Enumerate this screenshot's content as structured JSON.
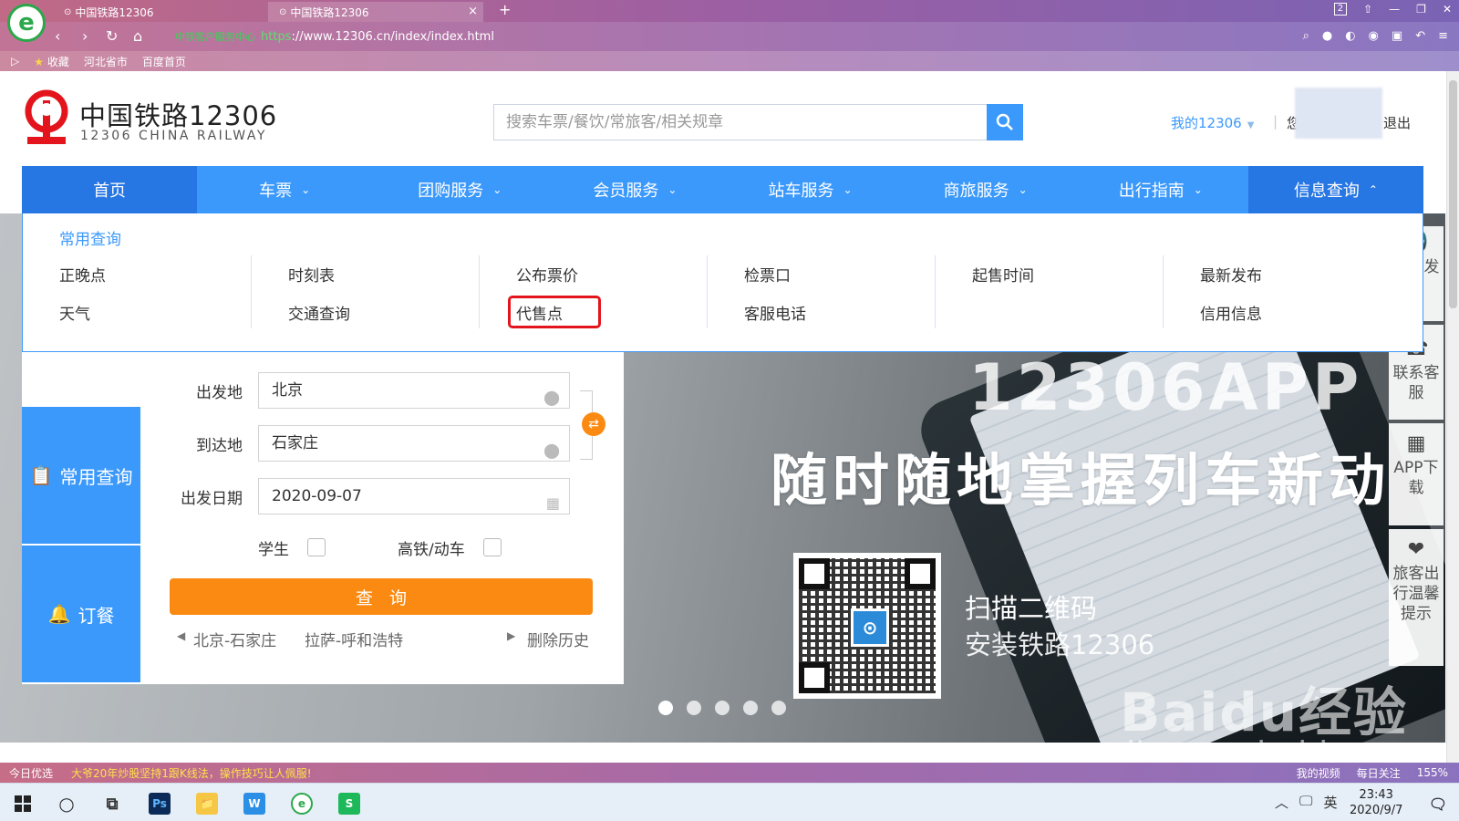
{
  "browser": {
    "logo_glyph": "e",
    "tabs": [
      {
        "icon": "⊙",
        "title": "中国铁路12306"
      },
      {
        "icon": "⊙",
        "title": "中国铁路12306",
        "close": "×"
      }
    ],
    "new_tab": "+",
    "window_badge": "2",
    "url_cert_label": "中铁客户服务中心",
    "url_scheme": "https",
    "url_rest": "://www.12306.cn/index/index.html",
    "bookmarks": [
      "收藏",
      "河北省市",
      "百度首页"
    ]
  },
  "header": {
    "logo_title": "中国铁路12306",
    "logo_sub": "12306 CHINA RAILWAY",
    "search_placeholder": "搜索车票/餐饮/常旅客/相关规章",
    "my12306": "我的12306",
    "separator": "|",
    "greeting_prefix": "您",
    "logout": "退出"
  },
  "nav": {
    "items": [
      {
        "label": "首页",
        "chevron": ""
      },
      {
        "label": "车票",
        "chevron": "⌄"
      },
      {
        "label": "团购服务",
        "chevron": "⌄"
      },
      {
        "label": "会员服务",
        "chevron": "⌄"
      },
      {
        "label": "站车服务",
        "chevron": "⌄"
      },
      {
        "label": "商旅服务",
        "chevron": "⌄"
      },
      {
        "label": "出行指南",
        "chevron": "⌄"
      },
      {
        "label": "信息查询",
        "chevron": "⌃"
      }
    ]
  },
  "dropdown": {
    "header": "常用查询",
    "columns": [
      [
        "正晚点",
        "天气"
      ],
      [
        "时刻表",
        "交通查询"
      ],
      [
        "公布票价",
        "代售点"
      ],
      [
        "检票口",
        "客服电话"
      ],
      [
        "起售时间",
        ""
      ],
      [
        "最新发布",
        "信用信息"
      ]
    ]
  },
  "booking": {
    "tabs": [
      {
        "icon": "📋",
        "label": "常用查询"
      },
      {
        "icon": "🔔",
        "label": "订餐"
      }
    ],
    "from_label": "出发地",
    "from_value": "北京",
    "to_label": "到达地",
    "to_value": "石家庄",
    "date_label": "出发日期",
    "date_value": "2020-09-07",
    "student_label": "学生",
    "highspeed_label": "高铁/动车",
    "query_label": "查询",
    "history": [
      "北京-石家庄",
      "拉萨-呼和浩特"
    ],
    "clear_history": "删除历史",
    "swap_glyph": "⇄"
  },
  "hero": {
    "app_title": "12306APP",
    "slogan": "随时随地掌握列车新动",
    "scan_text": "扫描二维码",
    "install_text": "安装铁路12306",
    "slide_count": 5,
    "active_slide": 0,
    "watermark_brand": "Baidu经验",
    "watermark_url": "jingyan.baidu.com"
  },
  "rail": [
    {
      "icon": "📢",
      "label": "最新发布"
    },
    {
      "icon": "☎",
      "label": "联系客服"
    },
    {
      "icon": "▦",
      "label": "APP下载"
    },
    {
      "icon": "❤",
      "label": "旅客出行温馨提示"
    }
  ],
  "statusbar": {
    "left": "今日优选",
    "news": "大爷20年炒股坚持1跟K线法，操作技巧让人佩服!",
    "right": [
      "我的视频",
      "每日关注",
      "155%"
    ]
  },
  "taskbar": {
    "clock_time": "23:43",
    "clock_date": "2020/9/7",
    "ime": "英",
    "apps": [
      "Ps",
      "📁",
      "W",
      "e",
      "S"
    ]
  },
  "colors": {
    "brand_blue": "#3b99fc",
    "brand_blue_dark": "#2676e3",
    "orange": "#fb8a12",
    "logo_red": "#e3141b",
    "highlight_red": "#e3141b"
  }
}
